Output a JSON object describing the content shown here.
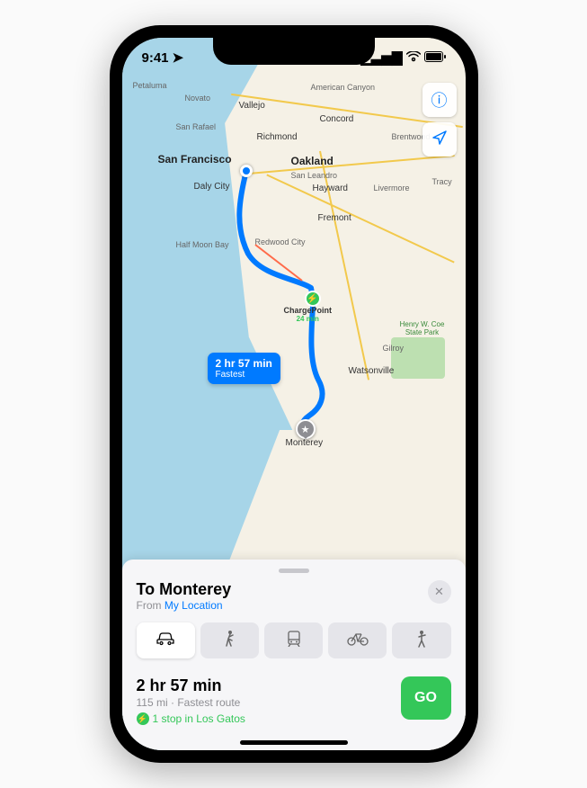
{
  "status": {
    "time": "9:41",
    "signal": "▮▮▮▮",
    "wifi": "wifi",
    "battery": "▮▮"
  },
  "top_buttons": {
    "info": "ⓘ",
    "locate": "➤"
  },
  "map": {
    "cities": {
      "petaluma": "Petaluma",
      "novato": "Novato",
      "am_canyon": "American Canyon",
      "vallejo": "Vallejo",
      "san_rafael": "San Rafael",
      "richmond": "Richmond",
      "concord": "Concord",
      "brentwood": "Brentwood",
      "san_francisco": "San Francisco",
      "oakland": "Oakland",
      "san_leandro": "San Leandro",
      "daly": "Daly City",
      "hayward": "Hayward",
      "livermore": "Livermore",
      "tracy": "Tracy",
      "fremont": "Fremont",
      "half_moon": "Half Moon Bay",
      "redwood": "Redwood City",
      "gilroy": "Gilroy",
      "watsonville": "Watsonville",
      "monterey": "Monterey",
      "chargepoint": "ChargePoint",
      "charge_time": "24 min"
    },
    "park": {
      "line1": "Henry W. Coe",
      "line2": "State Park"
    },
    "callout": {
      "time": "2 hr 57 min",
      "label": "Fastest"
    }
  },
  "sheet": {
    "to_prefix": "To ",
    "destination": "Monterey",
    "from_prefix": "From ",
    "from_location": "My Location",
    "close": "✕",
    "modes": [
      "car",
      "walk",
      "transit",
      "bike",
      "rideshare"
    ],
    "route": {
      "time": "2 hr 57 min",
      "distance": "115 mi",
      "separator": " · ",
      "type": "Fastest route",
      "stop": "1 stop in Los Gatos",
      "go": "GO"
    }
  }
}
